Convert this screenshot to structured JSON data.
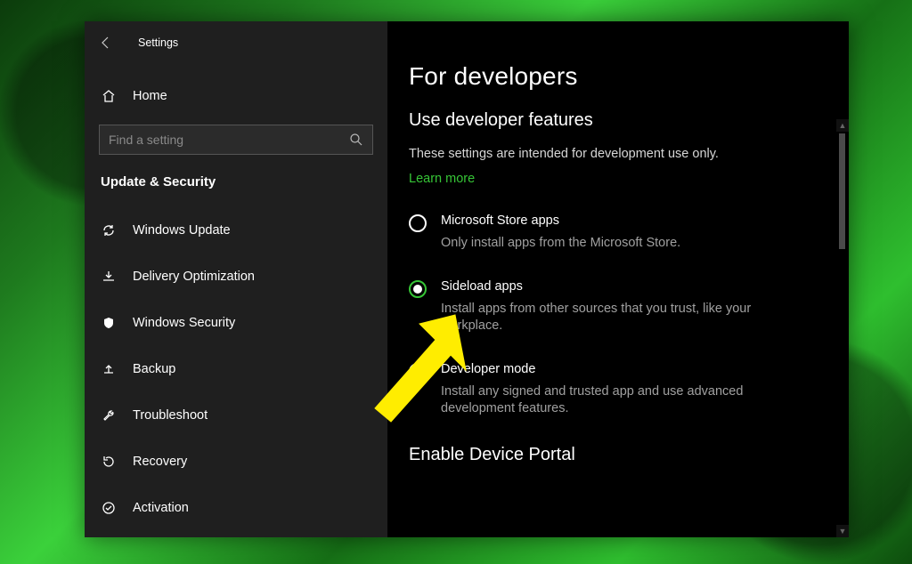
{
  "app_title": "Settings",
  "home_label": "Home",
  "search_placeholder": "Find a setting",
  "section_title": "Update & Security",
  "nav": {
    "items": [
      {
        "label": "Windows Update"
      },
      {
        "label": "Delivery Optimization"
      },
      {
        "label": "Windows Security"
      },
      {
        "label": "Backup"
      },
      {
        "label": "Troubleshoot"
      },
      {
        "label": "Recovery"
      },
      {
        "label": "Activation"
      }
    ]
  },
  "main": {
    "page_title": "For developers",
    "subtitle": "Use developer features",
    "description": "These settings are intended for development use only.",
    "learn_more": "Learn more",
    "options": [
      {
        "title": "Microsoft Store apps",
        "desc": "Only install apps from the Microsoft Store.",
        "selected": false
      },
      {
        "title": "Sideload apps",
        "desc": "Install apps from other sources that you trust, like your workplace.",
        "selected": true
      },
      {
        "title": "Developer mode",
        "desc": "Install any signed and trusted app and use advanced development features.",
        "selected": false
      }
    ],
    "section2": "Enable Device Portal"
  },
  "annotation": {
    "color": "#ffed00"
  }
}
